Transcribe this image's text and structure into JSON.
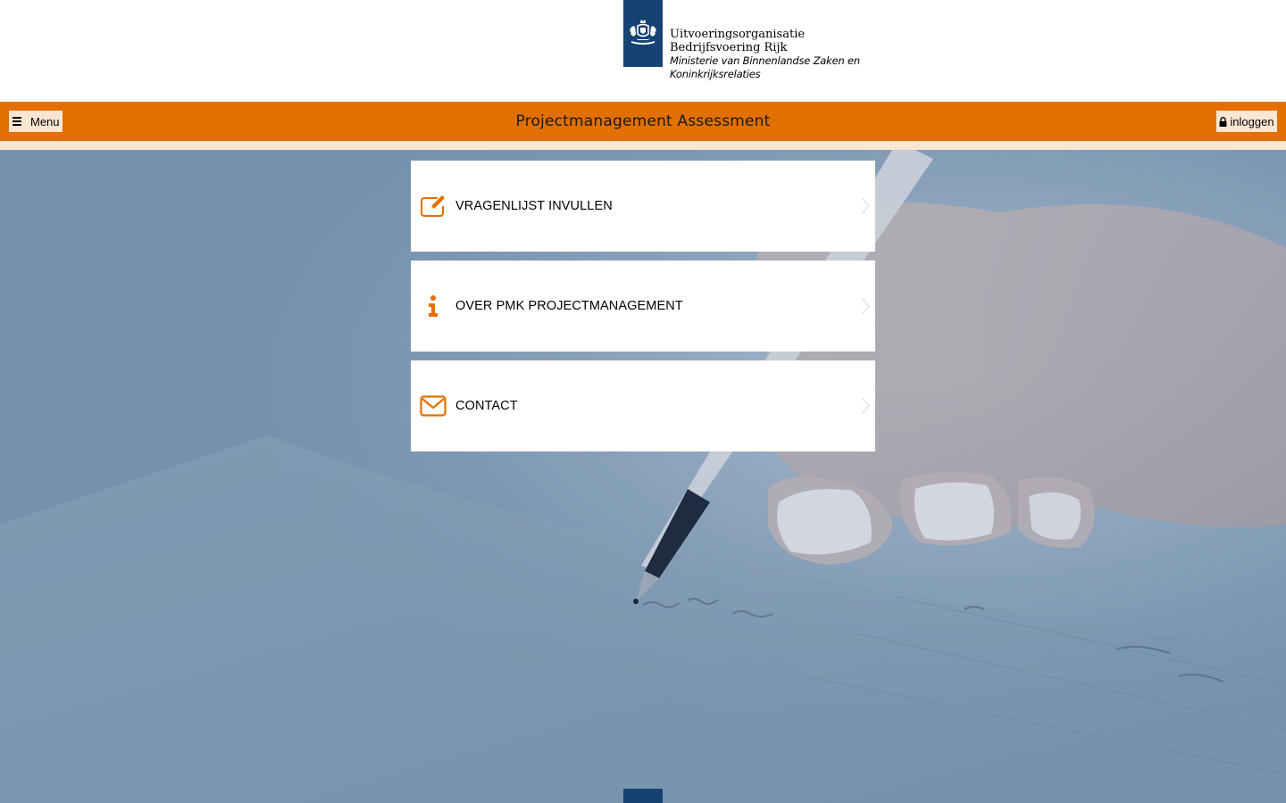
{
  "logo": {
    "line1": "Uitvoeringsorganisatie",
    "line2": "Bedrijfsvoering Rijk",
    "line3": "Ministerie van Binnenlandse Zaken en",
    "line4": "Koninkrijksrelaties",
    "emblem_icon": "rijkswapen-icon",
    "color": "#154273"
  },
  "navbar": {
    "menu_label": "Menu",
    "title": "Projectmanagement Assessment",
    "login_label": "inloggen",
    "color": "#e17000",
    "button_bg": "#fbe6d3"
  },
  "tiles": [
    {
      "label": "VRAGENLIJST INVULLEN",
      "icon": "edit-icon"
    },
    {
      "label": "OVER PMK PROJECTMANAGEMENT",
      "icon": "info-icon"
    },
    {
      "label": "CONTACT",
      "icon": "envelope-icon"
    }
  ],
  "colors": {
    "accent": "#e17000",
    "hero_overlay": "#7692ae"
  }
}
